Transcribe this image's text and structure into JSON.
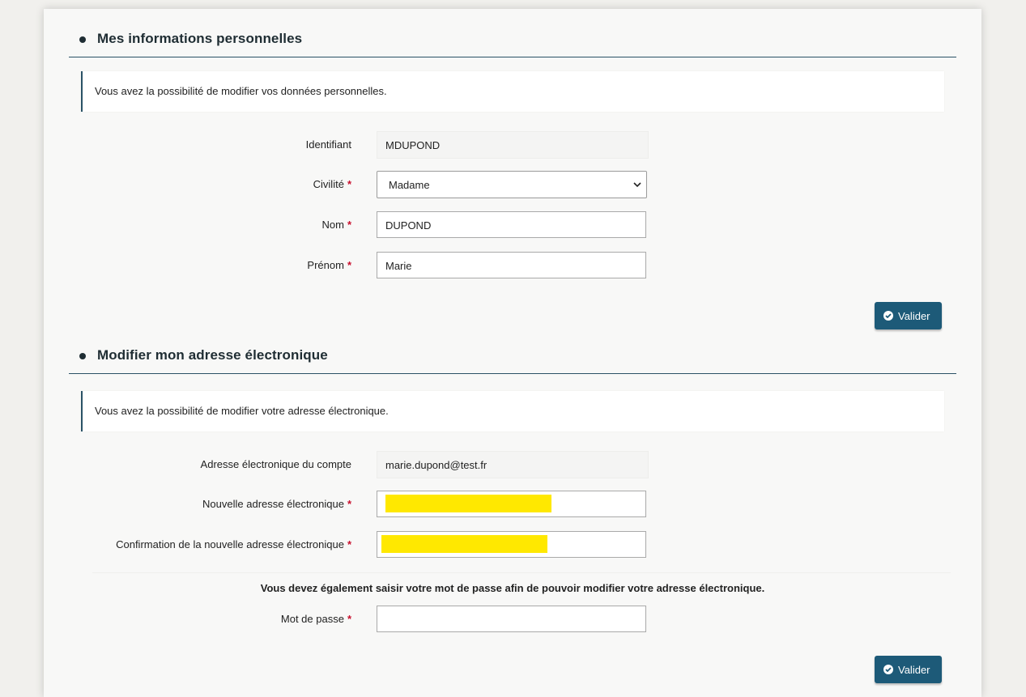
{
  "section1": {
    "title": "Mes informations personnelles",
    "info": "Vous avez la possibilité de modifier vos données personnelles.",
    "fields": {
      "identifiant": {
        "label": "Identifiant",
        "value": "MDUPOND"
      },
      "civilite": {
        "label": "Civilité",
        "required": "*",
        "value": "Madame"
      },
      "nom": {
        "label": "Nom",
        "required": "*",
        "value": "DUPOND"
      },
      "prenom": {
        "label": "Prénom",
        "required": "*",
        "value": "Marie"
      }
    },
    "submit_label": "Valider"
  },
  "section2": {
    "title": "Modifier mon adresse électronique",
    "info": "Vous avez la possibilité de modifier votre adresse électronique.",
    "fields": {
      "current_email": {
        "label": "Adresse électronique du compte",
        "value": "marie.dupond@test.fr"
      },
      "new_email": {
        "label": "Nouvelle adresse électronique",
        "required": "*",
        "value": ""
      },
      "confirm_email": {
        "label": "Confirmation de la nouvelle adresse électronique",
        "required": "*",
        "value": ""
      },
      "password": {
        "label": "Mot de passe",
        "required": "*",
        "value": ""
      }
    },
    "notice": "Vous devez également saisir votre mot de passe afin de pouvoir modifier votre adresse électronique.",
    "submit_label": "Valider"
  },
  "colors": {
    "primary": "#1d5a78",
    "required": "#c8102e",
    "highlight": "#ffe800"
  }
}
